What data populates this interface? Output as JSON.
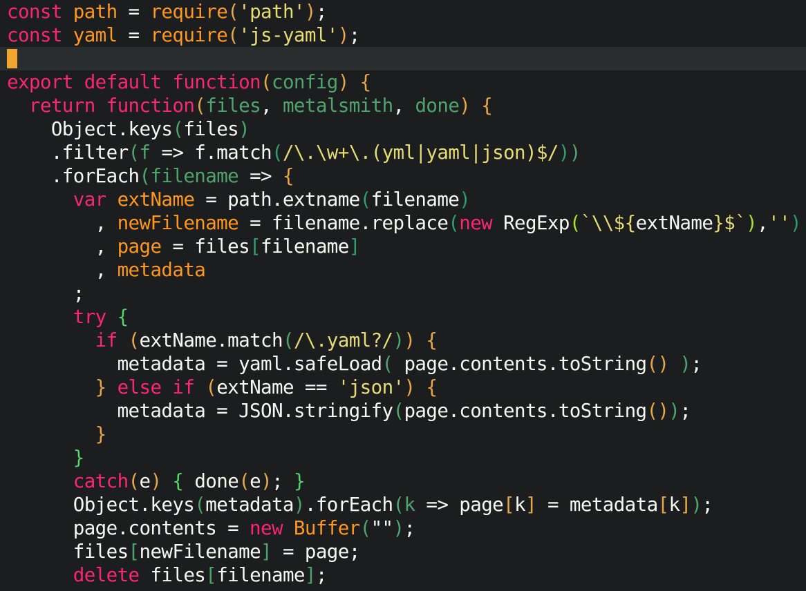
{
  "editor": {
    "colors": {
      "background": "#1b1d1e",
      "current_line": "#2a2d2e",
      "cursor": "#f0a630",
      "keyword": "#f92672",
      "variable": "#fd971f",
      "string": "#e6db74",
      "text": "#f8f8f2",
      "parameter": "#4fa36b"
    },
    "lines": [
      [
        {
          "c": "kw",
          "t": "const "
        },
        {
          "c": "var",
          "t": "path"
        },
        {
          "c": "txt",
          "t": " = "
        },
        {
          "c": "var",
          "t": "require"
        },
        {
          "c": "p1",
          "t": "("
        },
        {
          "c": "str",
          "t": "'path'"
        },
        {
          "c": "p1",
          "t": ")"
        },
        {
          "c": "txt",
          "t": ";"
        }
      ],
      [
        {
          "c": "kw",
          "t": "const "
        },
        {
          "c": "var",
          "t": "yaml"
        },
        {
          "c": "txt",
          "t": " = "
        },
        {
          "c": "var",
          "t": "require"
        },
        {
          "c": "p1",
          "t": "("
        },
        {
          "c": "str",
          "t": "'js-yaml'"
        },
        {
          "c": "p1",
          "t": ")"
        },
        {
          "c": "txt",
          "t": ";"
        }
      ],
      [],
      [
        {
          "c": "kw",
          "t": "export default "
        },
        {
          "c": "kw",
          "t": "function"
        },
        {
          "c": "p1",
          "t": "("
        },
        {
          "c": "param",
          "t": "config"
        },
        {
          "c": "p1",
          "t": ")"
        },
        {
          "c": "txt",
          "t": " "
        },
        {
          "c": "brace",
          "t": "{"
        }
      ],
      [
        {
          "c": "txt",
          "t": "  "
        },
        {
          "c": "kw",
          "t": "return "
        },
        {
          "c": "kw",
          "t": "function"
        },
        {
          "c": "p1",
          "t": "("
        },
        {
          "c": "param",
          "t": "files"
        },
        {
          "c": "txt",
          "t": ", "
        },
        {
          "c": "param",
          "t": "metalsmith"
        },
        {
          "c": "txt",
          "t": ", "
        },
        {
          "c": "param",
          "t": "done"
        },
        {
          "c": "p1",
          "t": ")"
        },
        {
          "c": "txt",
          "t": " "
        },
        {
          "c": "brace",
          "t": "{"
        }
      ],
      [
        {
          "c": "txt",
          "t": "    Object.keys"
        },
        {
          "c": "p2",
          "t": "("
        },
        {
          "c": "txt",
          "t": "files"
        },
        {
          "c": "p2",
          "t": ")"
        }
      ],
      [
        {
          "c": "txt",
          "t": "    .filter"
        },
        {
          "c": "p2",
          "t": "("
        },
        {
          "c": "param",
          "t": "f"
        },
        {
          "c": "txt",
          "t": " => f.match"
        },
        {
          "c": "p3",
          "t": "("
        },
        {
          "c": "str",
          "t": "/\\.\\w+\\.(yml|yaml|json)$/"
        },
        {
          "c": "p3",
          "t": ")"
        },
        {
          "c": "p2",
          "t": ")"
        }
      ],
      [
        {
          "c": "txt",
          "t": "    .forEach"
        },
        {
          "c": "p2",
          "t": "("
        },
        {
          "c": "param",
          "t": "filename"
        },
        {
          "c": "txt",
          "t": " => "
        },
        {
          "c": "brace",
          "t": "{"
        }
      ],
      [
        {
          "c": "txt",
          "t": "      "
        },
        {
          "c": "kw",
          "t": "var "
        },
        {
          "c": "var",
          "t": "extName"
        },
        {
          "c": "txt",
          "t": " = path.extname"
        },
        {
          "c": "p3",
          "t": "("
        },
        {
          "c": "txt",
          "t": "filename"
        },
        {
          "c": "p3",
          "t": ")"
        }
      ],
      [
        {
          "c": "txt",
          "t": "        , "
        },
        {
          "c": "var",
          "t": "newFilename"
        },
        {
          "c": "txt",
          "t": " = filename.replace"
        },
        {
          "c": "p3",
          "t": "("
        },
        {
          "c": "kw",
          "t": "new "
        },
        {
          "c": "txt",
          "t": "RegExp"
        },
        {
          "c": "p4",
          "t": "("
        },
        {
          "c": "str",
          "t": "`\\\\${"
        },
        {
          "c": "txt",
          "t": "extName"
        },
        {
          "c": "str",
          "t": "}$`"
        },
        {
          "c": "p4",
          "t": ")"
        },
        {
          "c": "txt",
          "t": ","
        },
        {
          "c": "str",
          "t": "''"
        },
        {
          "c": "p3",
          "t": ")"
        }
      ],
      [
        {
          "c": "txt",
          "t": "        , "
        },
        {
          "c": "var",
          "t": "page"
        },
        {
          "c": "txt",
          "t": " = files"
        },
        {
          "c": "p3",
          "t": "["
        },
        {
          "c": "txt",
          "t": "filename"
        },
        {
          "c": "p3",
          "t": "]"
        }
      ],
      [
        {
          "c": "txt",
          "t": "        , "
        },
        {
          "c": "var",
          "t": "metadata"
        }
      ],
      [
        {
          "c": "txt",
          "t": "      ;"
        }
      ],
      [
        {
          "c": "txt",
          "t": "      "
        },
        {
          "c": "kw",
          "t": "try "
        },
        {
          "c": "brace2",
          "t": "{"
        }
      ],
      [
        {
          "c": "txt",
          "t": "        "
        },
        {
          "c": "kw",
          "t": "if "
        },
        {
          "c": "p1",
          "t": "("
        },
        {
          "c": "txt",
          "t": "extName.match"
        },
        {
          "c": "p2",
          "t": "("
        },
        {
          "c": "str",
          "t": "/\\.yaml?/"
        },
        {
          "c": "p2",
          "t": ")"
        },
        {
          "c": "p1",
          "t": ")"
        },
        {
          "c": "txt",
          "t": " "
        },
        {
          "c": "brace",
          "t": "{"
        }
      ],
      [
        {
          "c": "txt",
          "t": "          metadata = yaml.safeLoad"
        },
        {
          "c": "p2",
          "t": "("
        },
        {
          "c": "txt",
          "t": " page.contents.toString"
        },
        {
          "c": "p1",
          "t": "()"
        },
        {
          "c": "txt",
          "t": " "
        },
        {
          "c": "p2",
          "t": ")"
        },
        {
          "c": "txt",
          "t": ";"
        }
      ],
      [
        {
          "c": "txt",
          "t": "        "
        },
        {
          "c": "brace",
          "t": "}"
        },
        {
          "c": "txt",
          "t": " "
        },
        {
          "c": "kw",
          "t": "else if "
        },
        {
          "c": "p1",
          "t": "("
        },
        {
          "c": "txt",
          "t": "extName == "
        },
        {
          "c": "str",
          "t": "'json'"
        },
        {
          "c": "p1",
          "t": ")"
        },
        {
          "c": "txt",
          "t": " "
        },
        {
          "c": "brace",
          "t": "{"
        }
      ],
      [
        {
          "c": "txt",
          "t": "          metadata = JSON.stringify"
        },
        {
          "c": "p2",
          "t": "("
        },
        {
          "c": "txt",
          "t": "page.contents.toString"
        },
        {
          "c": "p1",
          "t": "()"
        },
        {
          "c": "p2",
          "t": ")"
        },
        {
          "c": "txt",
          "t": ";"
        }
      ],
      [
        {
          "c": "txt",
          "t": "        "
        },
        {
          "c": "brace",
          "t": "}"
        }
      ],
      [
        {
          "c": "txt",
          "t": "      "
        },
        {
          "c": "brace2",
          "t": "}"
        }
      ],
      [
        {
          "c": "txt",
          "t": "      "
        },
        {
          "c": "kw",
          "t": "catch"
        },
        {
          "c": "p1",
          "t": "("
        },
        {
          "c": "txt",
          "t": "e"
        },
        {
          "c": "p1",
          "t": ")"
        },
        {
          "c": "txt",
          "t": " "
        },
        {
          "c": "brace2",
          "t": "{"
        },
        {
          "c": "txt",
          "t": " done"
        },
        {
          "c": "p1",
          "t": "("
        },
        {
          "c": "txt",
          "t": "e"
        },
        {
          "c": "p1",
          "t": ")"
        },
        {
          "c": "txt",
          "t": "; "
        },
        {
          "c": "brace2",
          "t": "}"
        }
      ],
      [
        {
          "c": "txt",
          "t": "      Object.keys"
        },
        {
          "c": "p2",
          "t": "("
        },
        {
          "c": "txt",
          "t": "metadata"
        },
        {
          "c": "p2",
          "t": ")"
        },
        {
          "c": "txt",
          "t": ".forEach"
        },
        {
          "c": "p2",
          "t": "("
        },
        {
          "c": "param",
          "t": "k"
        },
        {
          "c": "txt",
          "t": " => page"
        },
        {
          "c": "p1",
          "t": "["
        },
        {
          "c": "txt",
          "t": "k"
        },
        {
          "c": "p1",
          "t": "]"
        },
        {
          "c": "txt",
          "t": " = metadata"
        },
        {
          "c": "p1",
          "t": "["
        },
        {
          "c": "txt",
          "t": "k"
        },
        {
          "c": "p1",
          "t": "]"
        },
        {
          "c": "p2",
          "t": ")"
        },
        {
          "c": "txt",
          "t": ";"
        }
      ],
      [
        {
          "c": "txt",
          "t": "      page.contents = "
        },
        {
          "c": "kw",
          "t": "new "
        },
        {
          "c": "var",
          "t": "Buffer"
        },
        {
          "c": "p2",
          "t": "("
        },
        {
          "c": "txt",
          "t": "\"\""
        },
        {
          "c": "p2",
          "t": ")"
        },
        {
          "c": "txt",
          "t": ";"
        }
      ],
      [
        {
          "c": "txt",
          "t": "      files"
        },
        {
          "c": "p2",
          "t": "["
        },
        {
          "c": "txt",
          "t": "newFilename"
        },
        {
          "c": "p2",
          "t": "]"
        },
        {
          "c": "txt",
          "t": " = page;"
        }
      ],
      [
        {
          "c": "txt",
          "t": "      "
        },
        {
          "c": "kw",
          "t": "delete "
        },
        {
          "c": "txt",
          "t": "files"
        },
        {
          "c": "p2",
          "t": "["
        },
        {
          "c": "txt",
          "t": "filename"
        },
        {
          "c": "p2",
          "t": "]"
        },
        {
          "c": "txt",
          "t": ";"
        }
      ]
    ],
    "current_line": 2
  }
}
